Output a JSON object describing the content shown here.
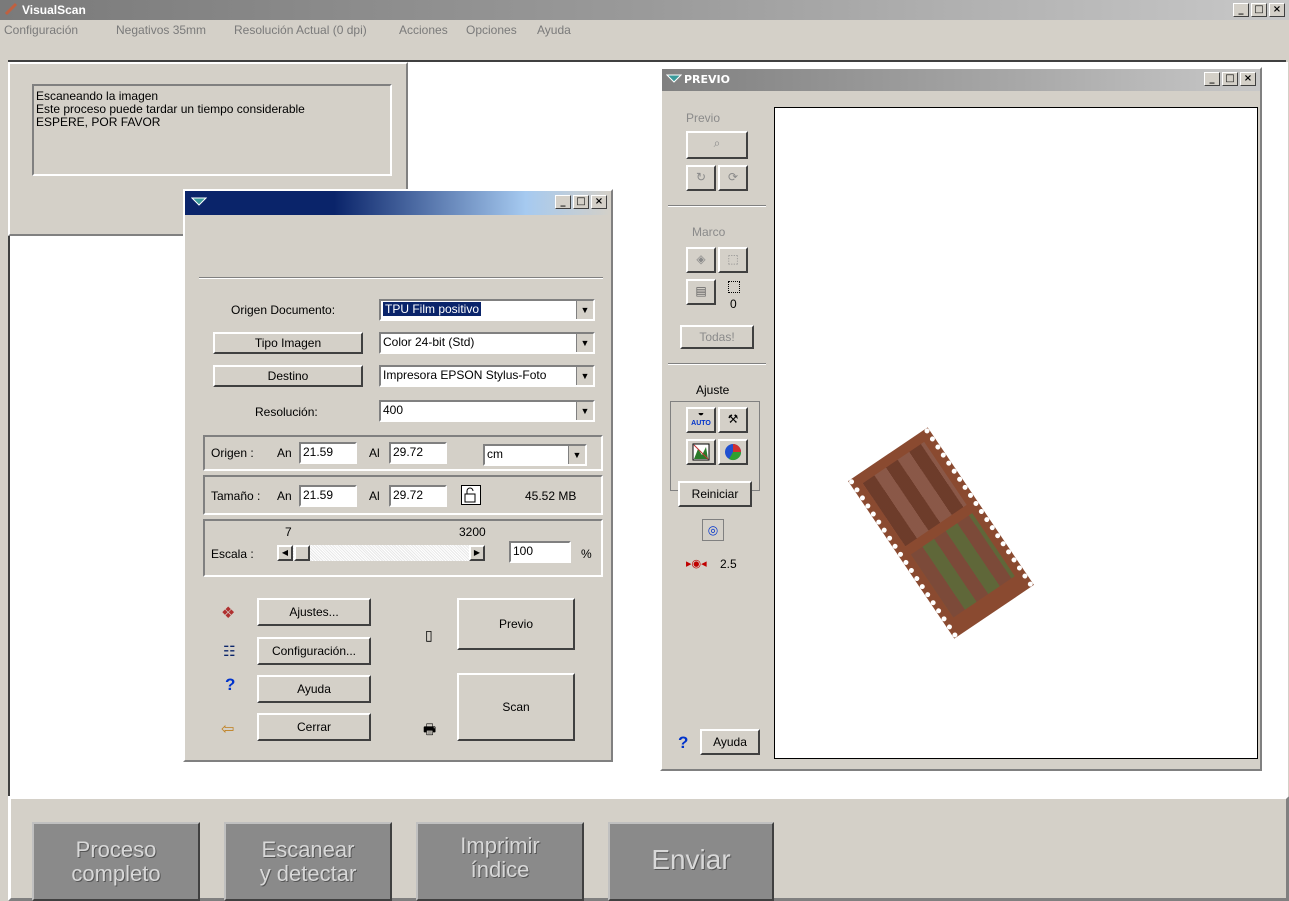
{
  "app": {
    "title": "VisualScan"
  },
  "menu": [
    "Configuración",
    "Negativos 35mm",
    "Resolución Actual (0 dpi)",
    "Acciones",
    "Opciones",
    "Ayuda"
  ],
  "status": {
    "lines": [
      "Escaneando la imagen",
      "Este proceso puede tardar un tiempo considerable",
      "ESPERE, POR FAVOR"
    ]
  },
  "scan_dialog": {
    "origin_label": "Origen Documento:",
    "origin_value": "TPU Film positivo",
    "image_type_button": "Tipo Imagen",
    "image_type_value": "Color 24-bit (Std)",
    "destination_button": "Destino",
    "destination_value": "Impresora EPSON Stylus-Foto",
    "resolution_label": "Resolución:",
    "resolution_value": "400",
    "origin_row": {
      "label": "Origen :",
      "an_label": "An",
      "an_value": "21.59",
      "al_label": "Al",
      "al_value": "29.72",
      "unit": "cm"
    },
    "size_row": {
      "label": "Tamaño :",
      "an_label": "An",
      "an_value": "21.59",
      "al_label": "Al",
      "al_value": "29.72",
      "size": "45.52 MB"
    },
    "scale": {
      "label": "Escala :",
      "min": "7",
      "max": "3200",
      "value": "100",
      "percent": "%"
    },
    "buttons": {
      "settings": "Ajustes...",
      "config": "Configuración...",
      "help": "Ayuda",
      "close": "Cerrar",
      "preview": "Previo",
      "scan": "Scan"
    }
  },
  "preview_window": {
    "title": "PREVIO",
    "preview_label": "Previo",
    "frame_label": "Marco",
    "frame_count": "0",
    "all_button": "Todas!",
    "adjust_label": "Ajuste",
    "reset_button": "Reiniciar",
    "zoom_value": "2.5",
    "help_button": "Ayuda",
    "auto_label": "AUTO"
  },
  "bottom_buttons": [
    {
      "line1": "Proceso",
      "line2": "completo"
    },
    {
      "line1": "Escanear",
      "line2": "y detectar"
    },
    {
      "line1": "Imprimir",
      "line2": "índice"
    },
    {
      "line1": "Enviar",
      "line2": ""
    }
  ]
}
